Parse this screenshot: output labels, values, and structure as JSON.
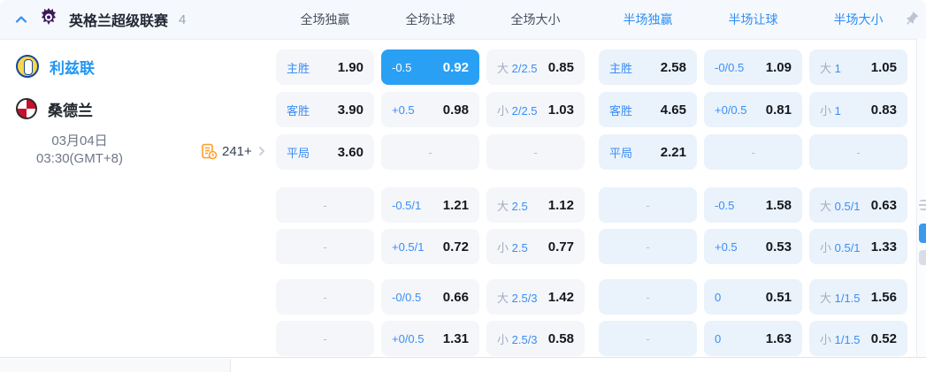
{
  "header": {
    "league": "英格兰超级联赛",
    "match_count": "4",
    "columns": [
      {
        "label": "全场独赢",
        "half": false
      },
      {
        "label": "全场让球",
        "half": false
      },
      {
        "label": "全场大小",
        "half": false
      },
      {
        "label": "半场独赢",
        "half": true
      },
      {
        "label": "半场让球",
        "half": true
      },
      {
        "label": "半场大小",
        "half": true
      }
    ]
  },
  "match": {
    "home_team": "利兹联",
    "away_team": "桑德兰",
    "date": "03月04日",
    "time": "03:30(GMT+8)",
    "more_markets": "241+"
  },
  "odds_groups": [
    {
      "rows": [
        [
          {
            "l": "主胜",
            "v": "1.90"
          },
          {
            "l": "-0.5",
            "v": "0.92",
            "sel": true
          },
          {
            "pre": "大",
            "l": "2/2.5",
            "v": "0.85"
          },
          {
            "l": "主胜",
            "v": "2.58"
          },
          {
            "l": "-0/0.5",
            "v": "1.09"
          },
          {
            "pre": "大",
            "l": "1",
            "v": "1.05"
          }
        ],
        [
          {
            "l": "客胜",
            "v": "3.90"
          },
          {
            "l": "+0.5",
            "v": "0.98"
          },
          {
            "pre": "小",
            "l": "2/2.5",
            "v": "1.03"
          },
          {
            "l": "客胜",
            "v": "4.65"
          },
          {
            "l": "+0/0.5",
            "v": "0.81"
          },
          {
            "pre": "小",
            "l": "1",
            "v": "0.83"
          }
        ],
        [
          {
            "l": "平局",
            "v": "3.60"
          },
          {
            "dash": true
          },
          {
            "dash": true
          },
          {
            "l": "平局",
            "v": "2.21"
          },
          {
            "dash": true
          },
          {
            "dash": true
          }
        ]
      ]
    },
    {
      "rows": [
        [
          {
            "dash": true
          },
          {
            "l": "-0.5/1",
            "v": "1.21"
          },
          {
            "pre": "大",
            "l": "2.5",
            "v": "1.12"
          },
          {
            "dash": true
          },
          {
            "l": "-0.5",
            "v": "1.58"
          },
          {
            "pre": "大",
            "l": "0.5/1",
            "v": "0.63"
          }
        ],
        [
          {
            "dash": true
          },
          {
            "l": "+0.5/1",
            "v": "0.72"
          },
          {
            "pre": "小",
            "l": "2.5",
            "v": "0.77"
          },
          {
            "dash": true
          },
          {
            "l": "+0.5",
            "v": "0.53"
          },
          {
            "pre": "小",
            "l": "0.5/1",
            "v": "1.33"
          }
        ]
      ]
    },
    {
      "rows": [
        [
          {
            "dash": true
          },
          {
            "l": "-0/0.5",
            "v": "0.66"
          },
          {
            "pre": "大",
            "l": "2.5/3",
            "v": "1.42"
          },
          {
            "dash": true
          },
          {
            "l": "0",
            "v": "0.51"
          },
          {
            "pre": "大",
            "l": "1/1.5",
            "v": "1.56"
          }
        ],
        [
          {
            "dash": true
          },
          {
            "l": "+0/0.5",
            "v": "1.31"
          },
          {
            "pre": "小",
            "l": "2.5/3",
            "v": "0.58"
          },
          {
            "dash": true
          },
          {
            "l": "0",
            "v": "1.63"
          },
          {
            "pre": "小",
            "l": "1/1.5",
            "v": "0.52"
          }
        ]
      ]
    }
  ],
  "icons": {
    "collapse": "chevron-up",
    "league_logo": "premier-league-lion",
    "pin": "pushpin",
    "more_markets": "odds-history",
    "forward": "chevron-right"
  },
  "colors": {
    "accent_blue": "#2f8ef5",
    "selected_cell_bg": "#2aa0f5",
    "full_cell_bg": "#f4f6f9",
    "half_cell_bg": "#eaf2fb",
    "odds_value_text": "#15181e",
    "prefix_gray": "#a3adc0",
    "home_team_blue": "#2397f2",
    "league_logo_purple": "#3d195b",
    "more_icon_orange": "#ff9e2c",
    "header_bg": "#f5f8fc"
  }
}
